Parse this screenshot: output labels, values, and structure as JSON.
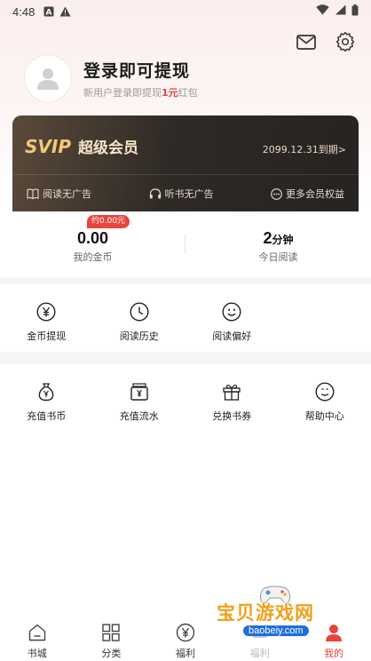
{
  "status_bar": {
    "time": "4:48"
  },
  "profile": {
    "login_title": "登录即可提现",
    "login_sub_prefix": "新用户登录即提现",
    "login_sub_amount": "1元",
    "login_sub_suffix": "红包"
  },
  "svip": {
    "badge": "SVIP",
    "name": "超级会员",
    "expire": "2099.12.31到期>",
    "perks": [
      {
        "label": "阅读无广告",
        "icon": "book-icon"
      },
      {
        "label": "听书无广告",
        "icon": "headphones-icon"
      },
      {
        "label": "更多会员权益",
        "icon": "more-icon"
      }
    ]
  },
  "stats": {
    "coins": {
      "value": "0.00",
      "label": "我的金币",
      "pill": "约0.00元"
    },
    "reading": {
      "value": "2",
      "unit": "分钟",
      "label": "今日阅读"
    }
  },
  "grid_row1": [
    {
      "label": "金币提现",
      "icon": "yen-circle-icon"
    },
    {
      "label": "阅读历史",
      "icon": "clock-icon"
    },
    {
      "label": "阅读偏好",
      "icon": "smile-icon"
    }
  ],
  "grid_row2": [
    {
      "label": "充值书币",
      "icon": "money-bag-icon"
    },
    {
      "label": "充值流水",
      "icon": "receipt-icon"
    },
    {
      "label": "兑换书券",
      "icon": "gift-icon"
    },
    {
      "label": "帮助中心",
      "icon": "help-face-icon"
    }
  ],
  "bottom_nav": [
    {
      "label": "书城",
      "icon": "home-icon",
      "active": false
    },
    {
      "label": "分类",
      "icon": "grid-icon",
      "active": false
    },
    {
      "label": "福利",
      "icon": "yen-icon",
      "active": false
    },
    {
      "label": "福利",
      "icon": "watch-icon",
      "active": false
    },
    {
      "label": "我的",
      "icon": "person-icon",
      "active": true
    }
  ],
  "watermark": {
    "text": "宝贝游戏网",
    "url": "baobeiy.com"
  },
  "colors": {
    "accent": "#e8453c",
    "gold": "#f3c877",
    "card_dark": "#2f2a26"
  }
}
